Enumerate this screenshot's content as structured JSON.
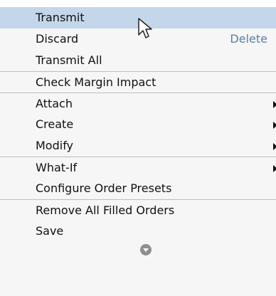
{
  "menu": {
    "items": [
      {
        "label": "Transmit",
        "highlighted": true
      },
      {
        "label": "Discard",
        "shortcut": "Delete"
      },
      {
        "label": "Transmit All"
      },
      {
        "label": "Check Margin Impact"
      },
      {
        "label": "Attach",
        "submenu": true
      },
      {
        "label": "Create",
        "submenu": true
      },
      {
        "label": "Modify",
        "submenu": true
      },
      {
        "label": "What-If",
        "submenu": true
      },
      {
        "label": "Configure Order Presets"
      },
      {
        "label": "Remove All Filled Orders"
      },
      {
        "label": "Save"
      }
    ],
    "more_icon": "chevron-down-circle-icon"
  },
  "colors": {
    "menu_background": "#f6f6f6",
    "highlight": "#c3d6ea",
    "separator": "#bdbdbd",
    "shortcut_text": "#5a7fa5"
  }
}
